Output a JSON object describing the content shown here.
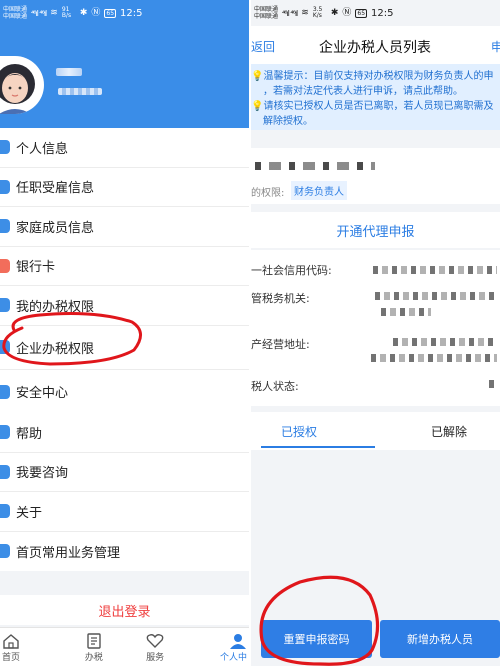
{
  "status_bar": {
    "carrier_1": "中国联通",
    "carrier_2": "中国联通",
    "signal": "⁴⁶ıl ⁴⁶ıl",
    "speed": "91 B/s",
    "speed_right": "3.5 K/s",
    "battery": "65",
    "time": "12:5"
  },
  "left": {
    "menu_primary": [
      {
        "label": "个人信息",
        "icon": "person-icon",
        "color": "#3d8ee6"
      },
      {
        "label": "任职受雇信息",
        "icon": "briefcase-icon",
        "color": "#3d8ee6"
      },
      {
        "label": "家庭成员信息",
        "icon": "family-icon",
        "color": "#3d8ee6"
      },
      {
        "label": "银行卡",
        "icon": "bank-card-icon",
        "color": "#f26d5b"
      },
      {
        "label": "我的办税权限",
        "icon": "permission-icon",
        "color": "#3d8ee6"
      },
      {
        "label": "企业办税权限",
        "icon": "enterprise-icon",
        "color": "#3d8ee6"
      },
      {
        "label": "安全中心",
        "icon": "shield-icon",
        "color": "#3d8ee6"
      }
    ],
    "menu_secondary": [
      {
        "label": "帮助",
        "icon": "help-icon",
        "color": "#3d8ee6"
      },
      {
        "label": "我要咨询",
        "icon": "consult-icon",
        "color": "#3d8ee6"
      },
      {
        "label": "关于",
        "icon": "about-icon",
        "color": "#3d8ee6"
      },
      {
        "label": "首页常用业务管理",
        "icon": "home-business-icon",
        "color": "#3d8ee6"
      }
    ],
    "logout": "退出登录",
    "tabs": [
      {
        "label": "首页",
        "icon": "home-icon"
      },
      {
        "label": "办税",
        "icon": "tax-icon"
      },
      {
        "label": "服务",
        "icon": "service-icon"
      },
      {
        "label": "个人中",
        "icon": "profile-icon",
        "active": true
      }
    ]
  },
  "right": {
    "back": "返回",
    "title": "企业办税人员列表",
    "nav_right": "申",
    "notice": {
      "line1": "温馨提示：目前仅支持对办税权限为财务负责人的申",
      "line2_pre": "，若需对法定代表人进行申诉，请",
      "line2_link": "点此帮助",
      "line2_post": "。",
      "line3": "请核实已授权人员是否已离职，若人员现已离职需及",
      "line4": "解除授权。"
    },
    "role_label": "的权限:",
    "role_value": "财务负责人",
    "agent_link": "开通代理申报",
    "fields": [
      {
        "label": "一社会信用代码:"
      },
      {
        "label": "管税务机关:"
      },
      {
        "label": "产经营地址:"
      },
      {
        "label": "税人状态:"
      }
    ],
    "tabs": [
      {
        "label": "已授权",
        "active": true
      },
      {
        "label": "已解除",
        "active": false
      }
    ],
    "buttons": {
      "reset": "重置申报密码",
      "add": "新增办税人员"
    }
  },
  "colors": {
    "brand_blue": "#3a8de8",
    "link_blue": "#2b7de3",
    "logout_red": "#ef3e3e",
    "annotation_red": "#e0161b"
  }
}
